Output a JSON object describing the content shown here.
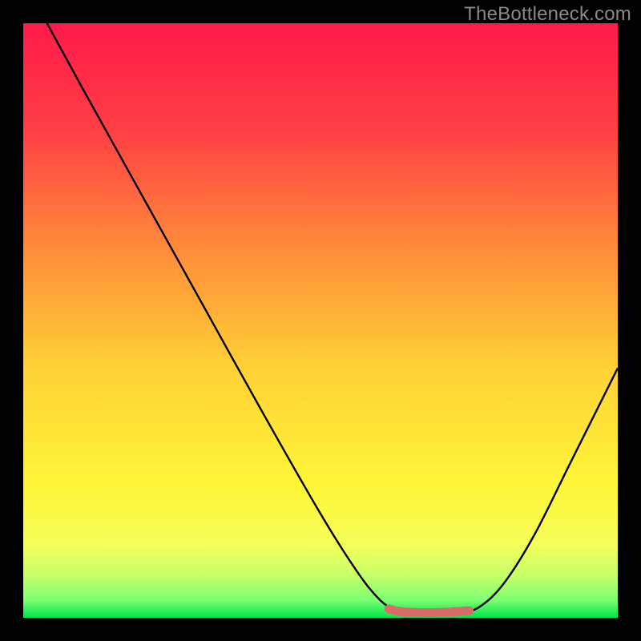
{
  "watermark": "TheBottleneck.com",
  "chart_data": {
    "type": "line",
    "title": "",
    "xlabel": "",
    "ylabel": "",
    "xlim": [
      0,
      100
    ],
    "ylim": [
      0,
      100
    ],
    "background_gradient": {
      "stops": [
        {
          "offset": 0.0,
          "color": "#ff1a4b"
        },
        {
          "offset": 0.18,
          "color": "#ff3f44"
        },
        {
          "offset": 0.38,
          "color": "#ff8c3a"
        },
        {
          "offset": 0.58,
          "color": "#ffd135"
        },
        {
          "offset": 0.78,
          "color": "#fff638"
        },
        {
          "offset": 0.88,
          "color": "#f3ff5a"
        },
        {
          "offset": 0.93,
          "color": "#c4ff6a"
        },
        {
          "offset": 0.97,
          "color": "#7cff72"
        },
        {
          "offset": 1.0,
          "color": "#00e64d"
        }
      ]
    },
    "series": [
      {
        "name": "bottleneck-curve",
        "color": "#000000",
        "width": 2.4,
        "points": [
          {
            "x": 4.0,
            "y": 100.0
          },
          {
            "x": 10.0,
            "y": 89.0
          },
          {
            "x": 20.0,
            "y": 71.0
          },
          {
            "x": 30.0,
            "y": 53.0
          },
          {
            "x": 40.0,
            "y": 35.0
          },
          {
            "x": 50.0,
            "y": 17.5
          },
          {
            "x": 56.0,
            "y": 8.0
          },
          {
            "x": 60.0,
            "y": 3.0
          },
          {
            "x": 63.0,
            "y": 1.2
          },
          {
            "x": 66.0,
            "y": 0.9
          },
          {
            "x": 70.0,
            "y": 0.9
          },
          {
            "x": 74.0,
            "y": 1.0
          },
          {
            "x": 77.0,
            "y": 2.0
          },
          {
            "x": 81.0,
            "y": 6.0
          },
          {
            "x": 86.0,
            "y": 14.0
          },
          {
            "x": 92.0,
            "y": 26.0
          },
          {
            "x": 98.0,
            "y": 38.0
          },
          {
            "x": 100.0,
            "y": 42.0
          }
        ]
      },
      {
        "name": "bottom-marker",
        "color": "#d96b6b",
        "width": 11,
        "cap": "round",
        "points": [
          {
            "x": 61.5,
            "y": 1.5
          },
          {
            "x": 64.0,
            "y": 1.0
          },
          {
            "x": 70.0,
            "y": 0.9
          },
          {
            "x": 75.0,
            "y": 1.2
          }
        ]
      }
    ]
  }
}
